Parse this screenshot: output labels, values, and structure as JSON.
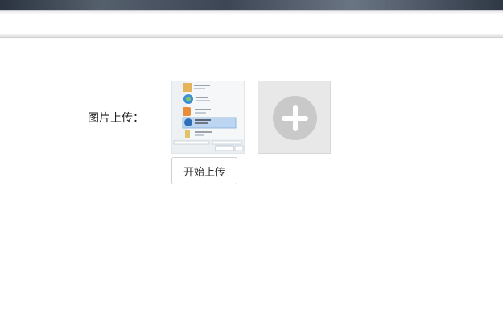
{
  "form": {
    "image_label": "图片上传：",
    "start_upload_label": "开始上传"
  },
  "icons": {
    "add": "plus-icon",
    "thumbnail": "image-thumbnail"
  },
  "colors": {
    "add_tile_bg": "#e8e8e8",
    "add_circle": "#c9c9c9"
  }
}
